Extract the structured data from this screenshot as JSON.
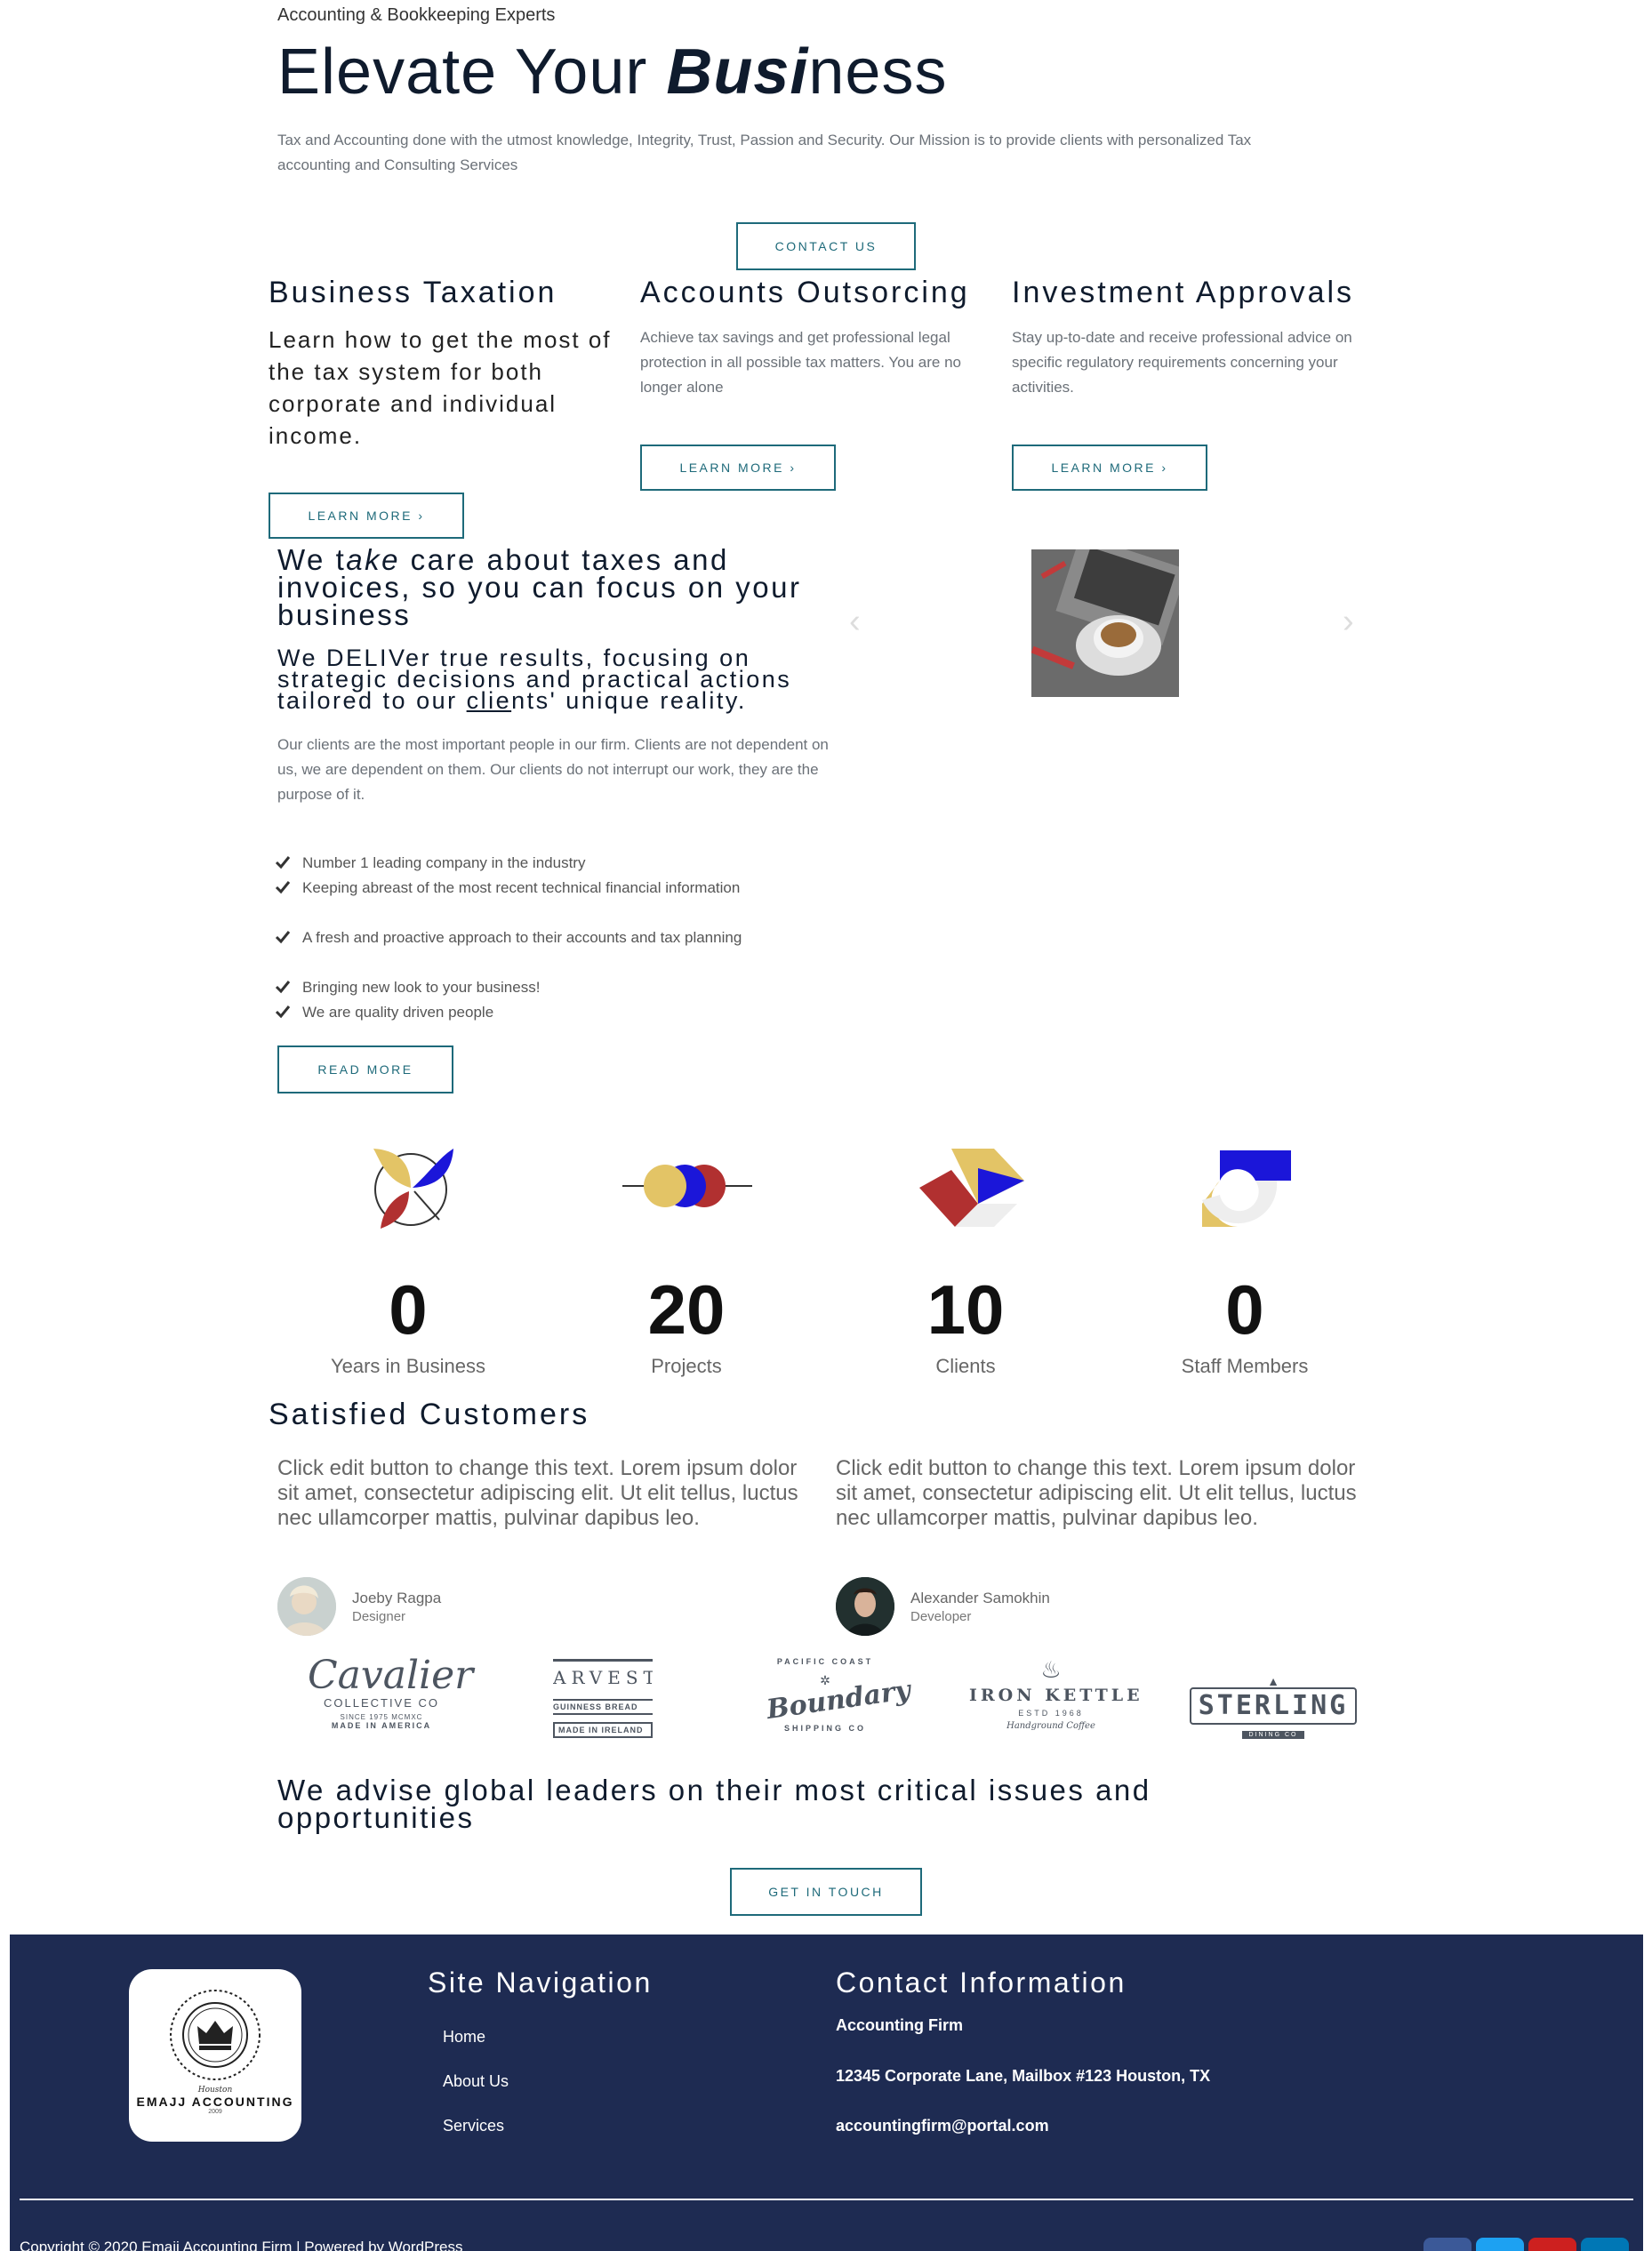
{
  "hero": {
    "eyebrow": "Accounting & Bookkeeping Experts",
    "title_pre": "Elevate Your ",
    "title_em": "Busi",
    "title_post": "ness",
    "description": "Tax and Accounting done with the utmost knowledge, Integrity, Trust, Passion and Security. Our Mission is to provide clients with personalized Tax accounting and Consulting Services",
    "cta_label": "CONTACT US"
  },
  "services": [
    {
      "title": "Business Taxation",
      "text": "Learn how to get the most of the tax system for both corporate and individual income.",
      "button": "LEARN MORE ›"
    },
    {
      "title": "Accounts Outsorcing",
      "text": "Achieve tax savings and get professional legal protection in all possible tax matters. You are no longer alone",
      "button": "LEARN MORE ›"
    },
    {
      "title": "Investment Approvals",
      "text": "Stay up-to-date and receive professional advice on specific regulatory requirements concerning your activities.",
      "button": "LEARN MORE ›"
    }
  ],
  "about": {
    "heading_pre": "We t",
    "heading_em": "ake",
    "heading_post": " care about taxes and invoices, so you can focus on your business",
    "subheading_pre": "We DELIVer true results, focusing on strategic decisions and practical actions tailored to our ",
    "subheading_u": "clie",
    "subheading_post": "nts' unique reality.",
    "paragraph": "Our clients are the most important people in our firm. Clients are not dependent on us, we are dependent on them. Our clients do not interrupt our work, they are the purpose of it.",
    "checklist": [
      "Number 1 leading company in the industry",
      "Keeping abreast of the most recent technical financial information",
      "A fresh and proactive approach to their accounts and tax planning",
      "Bringing new look to your business!",
      "We are quality driven people"
    ],
    "read_more": "READ MORE",
    "carousel_prev": "‹",
    "carousel_next": "›"
  },
  "stats": [
    {
      "value": "0",
      "label": "Years in Business"
    },
    {
      "value": "20",
      "label": "Projects"
    },
    {
      "value": "10",
      "label": "Clients"
    },
    {
      "value": "0",
      "label": "Staff Members"
    }
  ],
  "testimonials": {
    "heading": "Satisfied Customers",
    "items": [
      {
        "text": "Click edit button to change this text. Lorem ipsum dolor sit amet, consectetur adipiscing elit. Ut elit tellus, luctus nec ullamcorper mattis, pulvinar dapibus leo.",
        "name": "Joeby Ragpa",
        "role": "Designer"
      },
      {
        "text": "Click edit button to change this text. Lorem ipsum dolor sit amet, consectetur adipiscing elit. Ut elit tellus, luctus nec ullamcorper mattis, pulvinar dapibus leo.",
        "name": "Alexander Samokhin",
        "role": "Developer"
      }
    ]
  },
  "client_logos": {
    "cavalier": {
      "main": "Cavalier",
      "sub": "COLLECTIVE CO",
      "since": "SINCE 1975 MCMXC",
      "bottom": "MADE IN AMERICA"
    },
    "harvest": {
      "main": "ARVEST C",
      "sub": "GUINNESS BREAD",
      "bottom": "MADE IN IRELAND"
    },
    "boundary": {
      "main": "Boundary",
      "top": "PACIFIC COAST",
      "bottom": "SHIPPING CO"
    },
    "ironkettle": {
      "main": "IRON KETTLE",
      "sub": "ESTD 1968",
      "bottom": "Handground Coffee"
    },
    "sterling": {
      "main": "STERLING",
      "sub": "DINING CO"
    }
  },
  "cta": {
    "heading": "We advise global leaders on their most critical issues and opportunities",
    "button": "GET IN TOUCH"
  },
  "footer": {
    "logo_script": "Houston",
    "logo_name": "EMAJJ ACCOUNTING",
    "logo_year": "2009",
    "nav_heading": "Site Navigation",
    "nav_items": [
      "Home",
      "About Us",
      "Services"
    ],
    "contact_heading": "Contact Information",
    "contact_lines": [
      "Accounting Firm",
      "12345 Corporate Lane, Mailbox #123 Houston, TX",
      "accountingfirm@portal.com"
    ],
    "copyright": "Copyright © 2020 Emajj Accounting Firm | Powered by WordPress",
    "social": [
      "pinterest-icon",
      "twitter-icon",
      "youtube-icon",
      "linkedin-icon"
    ]
  },
  "colors": {
    "accent": "#1e6a7a",
    "footer_bg": "#1e2b52",
    "icon_yellow": "#e3c466",
    "icon_blue": "#1b16d9",
    "icon_red": "#b13030"
  }
}
